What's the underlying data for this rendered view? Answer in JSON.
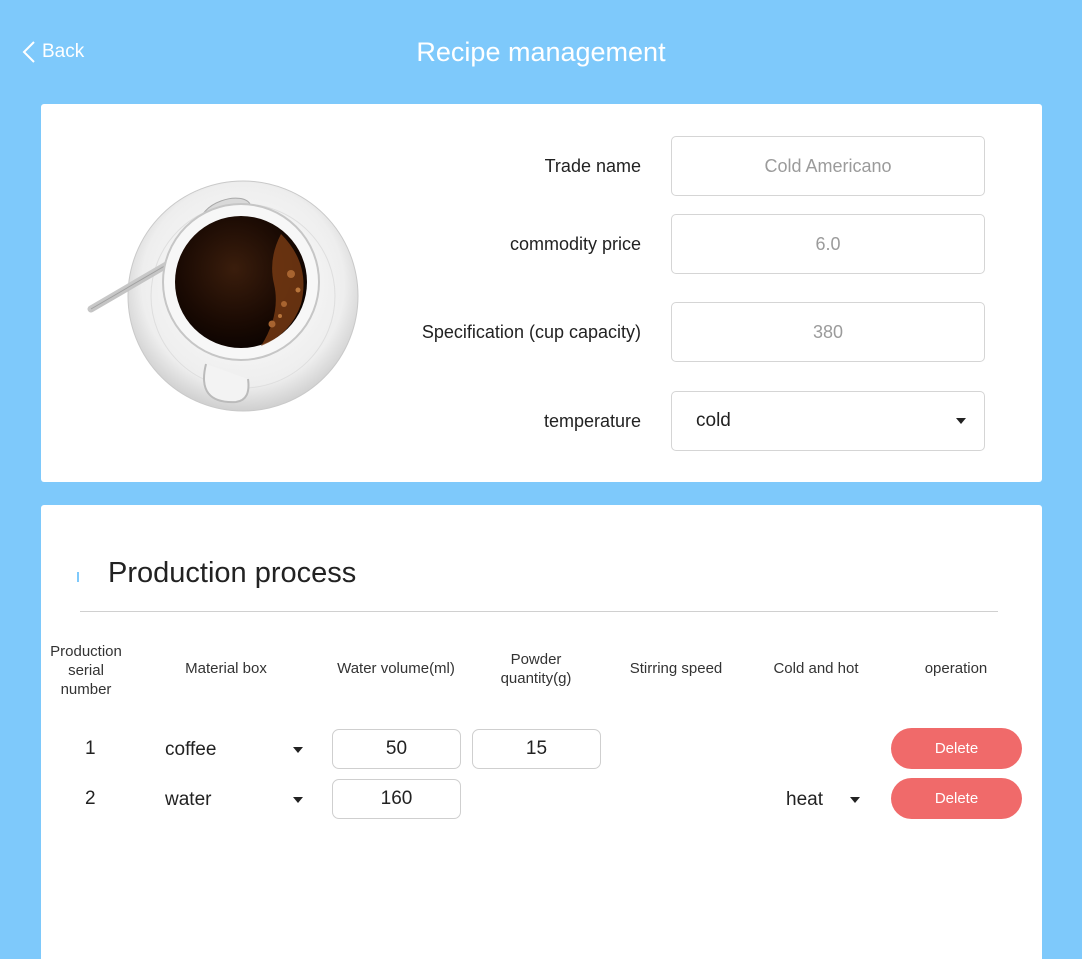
{
  "header": {
    "back_label": "Back",
    "title": "Recipe management"
  },
  "product": {
    "image": "coffee-cup-image",
    "fields": {
      "trade_name": {
        "label": "Trade name",
        "value": "Cold Americano"
      },
      "price": {
        "label": "commodity price",
        "value": "6.0"
      },
      "spec": {
        "label": "Specification (cup capacity)",
        "value": "380"
      },
      "temperature": {
        "label": "temperature",
        "value": "cold"
      }
    }
  },
  "process": {
    "title": "Production process",
    "columns": {
      "serial": "Production serial number",
      "material": "Material box",
      "water": "Water volume(ml)",
      "powder": "Powder quantity(g)",
      "stirring": "Stirring speed",
      "cold_hot": "Cold and hot",
      "operation": "operation"
    },
    "rows": [
      {
        "serial": "1",
        "material": "coffee",
        "water": "50",
        "powder": "15",
        "stirring": "",
        "cold_hot": "",
        "action": "Delete"
      },
      {
        "serial": "2",
        "material": "water",
        "water": "160",
        "powder": "",
        "stirring": "",
        "cold_hot": "heat",
        "action": "Delete"
      }
    ]
  },
  "colors": {
    "background": "#7ec9fb",
    "delete_button": "#f06a6a"
  }
}
